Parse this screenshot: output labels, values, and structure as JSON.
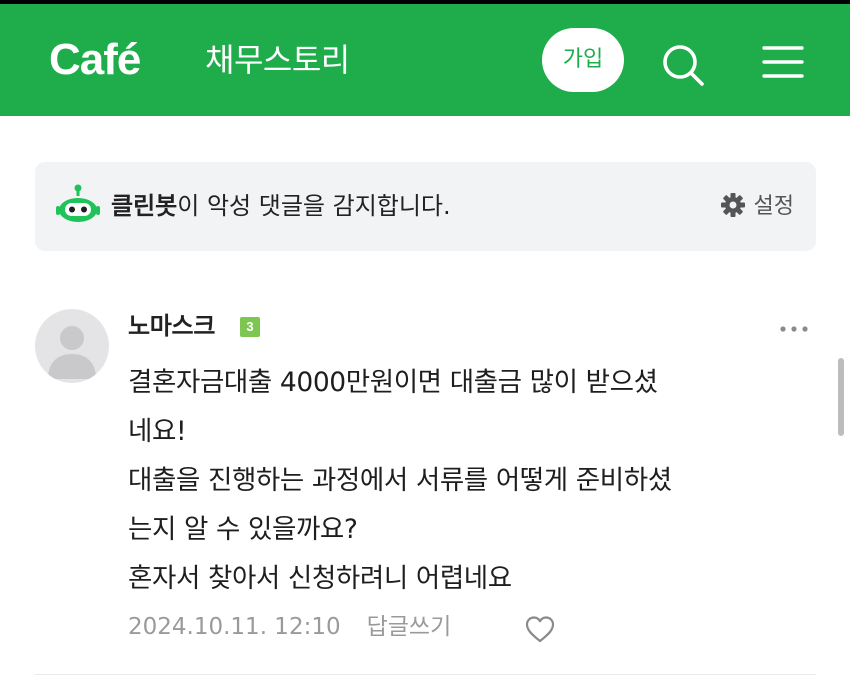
{
  "header": {
    "logo": "Café",
    "cafe_name": "채무스토리",
    "join_label": "가입",
    "colors": {
      "brand": "#1fad4b"
    },
    "icons": [
      "search-icon",
      "menu-icon"
    ]
  },
  "cleanbot": {
    "name": "클린봇",
    "message": "이 악성 댓글을 감지합니다.",
    "settings_label": "설정",
    "icons": [
      "cleanbot-icon",
      "gear-icon"
    ]
  },
  "comment": {
    "author": "노마스크",
    "level": "3",
    "lines": [
      "결혼자금대출 4000만원이면 대출금 많이 받으셨",
      "네요!",
      "대출을 진행하는 과정에서 서류를 어떻게 준비하셨",
      "는지 알 수 있을까요?",
      "혼자서 찾아서 신청하려니 어렵네요"
    ],
    "timestamp": "2024.10.11. 12:10",
    "reply_label": "답글쓰기",
    "icons": [
      "more-icon",
      "heart-icon",
      "avatar"
    ]
  }
}
